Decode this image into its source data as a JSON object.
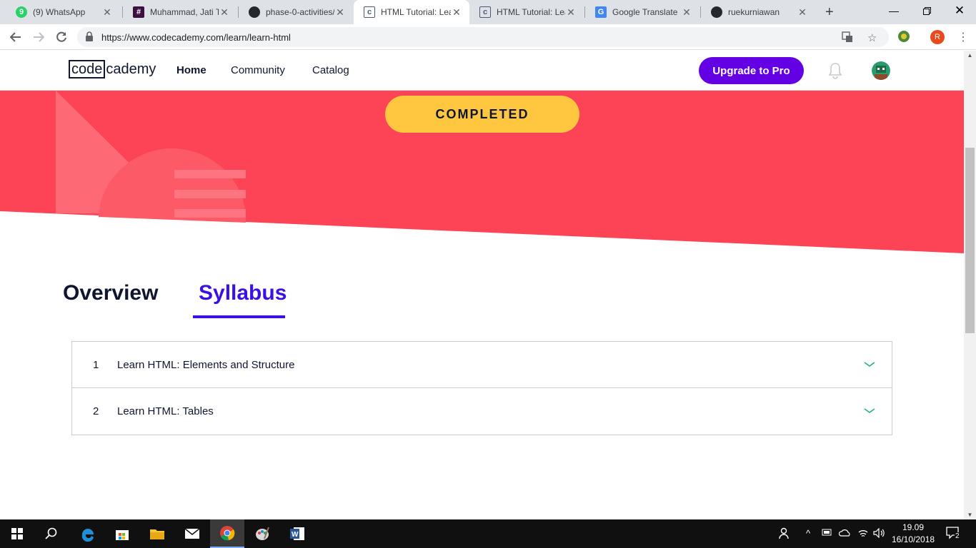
{
  "browser": {
    "tabs": [
      {
        "title": "(9) WhatsApp",
        "icon": "whatsapp-icon",
        "badge": "9"
      },
      {
        "title": "Muhammad, Jati T",
        "icon": "slack-icon"
      },
      {
        "title": "phase-0-activities/",
        "icon": "github-icon"
      },
      {
        "title": "HTML Tutorial: Lea",
        "icon": "codecademy-icon",
        "active": true
      },
      {
        "title": "HTML Tutorial: Lea",
        "icon": "codecademy-icon"
      },
      {
        "title": "Google Translate",
        "icon": "google-translate-icon"
      },
      {
        "title": "ruekurniawan",
        "icon": "github-icon"
      }
    ],
    "url": "https://www.codecademy.com/learn/learn-html",
    "profile_initial": "R"
  },
  "header": {
    "logo_box": "code",
    "logo_rest": "cademy",
    "nav": {
      "home": "Home",
      "community": "Community",
      "catalog": "Catalog"
    },
    "upgrade_label": "Upgrade to Pro"
  },
  "banner": {
    "status_label": "COMPLETED",
    "colors": {
      "background": "#fc4456",
      "status": "#ffc740"
    }
  },
  "content_tabs": {
    "overview": "Overview",
    "syllabus": "Syllabus",
    "active": "syllabus"
  },
  "syllabus": {
    "items": [
      {
        "number": "1",
        "title": "Learn HTML: Elements and Structure"
      },
      {
        "number": "2",
        "title": "Learn HTML: Tables"
      }
    ]
  },
  "taskbar": {
    "clock_time": "19.09",
    "clock_date": "16/10/2018",
    "notification_count": "2"
  },
  "colors": {
    "brand_purple": "#6400e4",
    "accent_blue": "#3a10e5",
    "chevron_green": "#21af84"
  }
}
